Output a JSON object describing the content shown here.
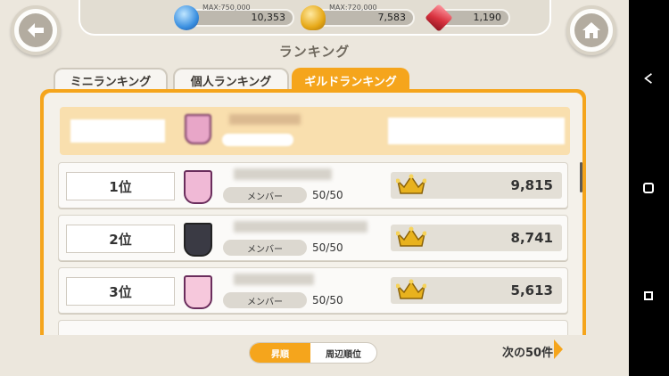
{
  "header": {
    "title": "ランキング",
    "resources": [
      {
        "name": "blue-orb",
        "max_label": "MAX:750,000",
        "value": "10,353",
        "color": "#3a8fe0"
      },
      {
        "name": "gold-heart",
        "max_label": "MAX:720,000",
        "value": "7,583",
        "color": "#e6a817"
      },
      {
        "name": "red-gem",
        "max_label": "",
        "value": "1,190",
        "color": "#d8323f"
      }
    ],
    "back_icon": "back-arrow-icon",
    "home_icon": "home-icon"
  },
  "tabs": [
    {
      "label": "ミニランキング",
      "active": false
    },
    {
      "label": "個人ランキング",
      "active": false
    },
    {
      "label": "ギルドランキング",
      "active": true
    }
  ],
  "rows": [
    {
      "rank": "1位",
      "member_label": "メンバー",
      "members": "50/50",
      "score": "9,815",
      "emblem_color": "#f0b9d6"
    },
    {
      "rank": "2位",
      "member_label": "メンバー",
      "members": "50/50",
      "score": "8,741",
      "emblem_color": "#3a3a44"
    },
    {
      "rank": "3位",
      "member_label": "メンバー",
      "members": "50/50",
      "score": "5,613",
      "emblem_color": "#f6c8dc"
    }
  ],
  "footer": {
    "sort_asc": "昇順",
    "sort_nearby": "周辺順位",
    "next_label": "次の50件"
  },
  "colors": {
    "accent": "#f5a51c",
    "background": "#ece7dd"
  }
}
